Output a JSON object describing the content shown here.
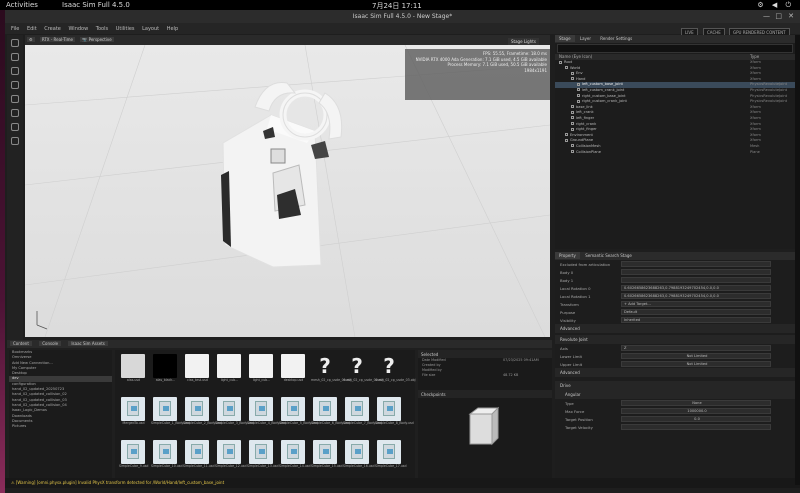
{
  "os": {
    "activities": "Activities",
    "app_name": "Isaac Sim Full 4.5.0",
    "clock": "7月24日  17:11",
    "tray": "⚙ ◀ ⏻"
  },
  "window": {
    "title": "Isaac Sim Full 4.5.0 - New Stage*",
    "minimize": "—",
    "maximize": "□",
    "close": "✕"
  },
  "menu": [
    "File",
    "Edit",
    "Create",
    "Window",
    "Tools",
    "Utilities",
    "Layout",
    "Help"
  ],
  "menu_status": {
    "live": "LIVE",
    "cache": "CACHE",
    "mode": "GPU RENDERED CONTENT"
  },
  "viewport": {
    "toolbar": [
      "⚙",
      "RTX - Real-Time",
      "📷 Perspective"
    ],
    "stage_lights": "Stage Lights",
    "hud": [
      "FPS: 55.55, Frametime: 18.0 ms",
      "NVIDIA RTX 4000 Ada Generation: 7.1 GiB used, 4.5 GiB available",
      "",
      "",
      "Process Memory: 7.1 GiB used, 50.5 GiB available",
      "1984x1191"
    ]
  },
  "stage": {
    "tabs": [
      "Stage",
      "Layer",
      "Render Settings"
    ],
    "columns": {
      "name": "Name (Eye Icon)",
      "type": "Type"
    },
    "rows": [
      {
        "indent": 0,
        "name": "Root",
        "type": "Xform",
        "sel": false
      },
      {
        "indent": 1,
        "name": "World",
        "type": "Xform",
        "sel": false
      },
      {
        "indent": 2,
        "name": "Env",
        "type": "Xform",
        "sel": false
      },
      {
        "indent": 2,
        "name": "Hand",
        "type": "Xform",
        "sel": false
      },
      {
        "indent": 3,
        "name": "left_custom_base_joint",
        "type": "PhysicsRevoluteJoint",
        "sel": true
      },
      {
        "indent": 3,
        "name": "left_custom_crank_joint",
        "type": "PhysicsRevoluteJoint",
        "sel": false
      },
      {
        "indent": 3,
        "name": "right_custom_base_joint",
        "type": "PhysicsRevoluteJoint",
        "sel": false
      },
      {
        "indent": 3,
        "name": "right_custom_crank_joint",
        "type": "PhysicsRevoluteJoint",
        "sel": false
      },
      {
        "indent": 2,
        "name": "base_link",
        "type": "Xform",
        "sel": false
      },
      {
        "indent": 2,
        "name": "left_crank",
        "type": "Xform",
        "sel": false
      },
      {
        "indent": 2,
        "name": "left_finger",
        "type": "Xform",
        "sel": false
      },
      {
        "indent": 2,
        "name": "right_crank",
        "type": "Xform",
        "sel": false
      },
      {
        "indent": 2,
        "name": "right_finger",
        "type": "Xform",
        "sel": false
      },
      {
        "indent": 1,
        "name": "Environment",
        "type": "Xform",
        "sel": false
      },
      {
        "indent": 1,
        "name": "GroundPlane",
        "type": "Xform",
        "sel": false
      },
      {
        "indent": 2,
        "name": "CollisionMesh",
        "type": "Mesh",
        "sel": false
      },
      {
        "indent": 2,
        "name": "CollisionPlane",
        "type": "Plane",
        "sel": false
      }
    ]
  },
  "property": {
    "tabs": [
      "Property",
      "Semantic Search Stage"
    ],
    "rows": [
      {
        "label": "Excluded from articulation",
        "value": ""
      },
      {
        "label": "Body 0",
        "value": ""
      },
      {
        "label": "Body 1",
        "value": ""
      },
      {
        "label": "Local Rotation 0",
        "value": "0.6026658623688263,0.7988193249702454,0.0,0.0"
      },
      {
        "label": "Local Rotation 1",
        "value": "0.6026658623688263,0.7988193249702454,0.0,0.0"
      },
      {
        "label": "Transform",
        "value": "+ Add Target..."
      },
      {
        "label": "Purpose",
        "value": "Default"
      },
      {
        "label": "Visibility",
        "value": "Inherited"
      }
    ],
    "sec_advanced": "Advanced",
    "sec_revolute": "Revolute Joint",
    "axis": {
      "label": "Axis",
      "value": "Z"
    },
    "lower_limit": {
      "label": "Lower Limit",
      "value": "Not Limited"
    },
    "upper_limit": {
      "label": "Upper Limit",
      "value": "Not Limited"
    },
    "sec_advanced2": "Advanced",
    "sec_drive": "Drive",
    "sec_angular": "Angular",
    "drive_rows": [
      {
        "label": "Type",
        "value": "None"
      },
      {
        "label": "Max Force",
        "value": "1000000.0"
      },
      {
        "label": "Target Position",
        "value": "0.0"
      },
      {
        "label": "Target Velocity",
        "value": ""
      }
    ]
  },
  "content": {
    "tabs": [
      "Content",
      "Console",
      "Isaac Sim Assets"
    ],
    "tree": [
      {
        "name": "Bookmarks",
        "sel": false
      },
      {
        "name": "Omniverse",
        "sel": false
      },
      {
        "name": "Add New Connection...",
        "sel": false
      },
      {
        "name": "My Computer",
        "sel": false
      },
      {
        "name": "Desktop",
        "sel": false
      },
      {
        "name": "dev",
        "sel": true
      },
      {
        "name": "configuration",
        "sel": false
      },
      {
        "name": "hand_02_updated_20250723",
        "sel": false
      },
      {
        "name": "hand_02_updated_collision_02",
        "sel": false
      },
      {
        "name": "hand_02_updated_collision_03",
        "sel": false
      },
      {
        "name": "hand_02_updated_collision_04",
        "sel": false
      },
      {
        "name": "Isaac_Logic_Demos",
        "sel": false
      },
      {
        "name": "Downloads",
        "sel": false
      },
      {
        "name": "Documents",
        "sel": false
      },
      {
        "name": "Pictures",
        "sel": false
      }
    ],
    "files": [
      {
        "name": "alas.usd",
        "kind": "dark"
      },
      {
        "name": "alas_black...",
        "kind": "black"
      },
      {
        "name": "clas_test.usd",
        "kind": "white"
      },
      {
        "name": "light_cub...",
        "kind": "white"
      },
      {
        "name": "light_cub...",
        "kind": "white"
      },
      {
        "name": "desktop.usd",
        "kind": "white"
      },
      {
        "name": "mesh_02_cp_usde_01.obj",
        "kind": "q"
      },
      {
        "name": "mesh_02_cp_usde_02.obj",
        "kind": "q"
      },
      {
        "name": "mesh_02_cp_usde_03.obj",
        "kind": "q"
      },
      {
        "name": "MergedTo.usd",
        "kind": "doc"
      },
      {
        "name": "SimpleCube_1_Body.usd",
        "kind": "doc"
      },
      {
        "name": "SimpleCube_2_Body.usd",
        "kind": "doc"
      },
      {
        "name": "SimpleCube_3_Body.usd",
        "kind": "doc"
      },
      {
        "name": "SimpleCube_4_Body.usd",
        "kind": "doc"
      },
      {
        "name": "SimpleCube_5_Body.usd",
        "kind": "doc"
      },
      {
        "name": "SimpleCube_6_Body.usd",
        "kind": "doc"
      },
      {
        "name": "SimpleCube_7_Body.usd",
        "kind": "doc"
      },
      {
        "name": "SimpleCube_8_Body.usd",
        "kind": "doc"
      },
      {
        "name": "SimpleCube_9.usd",
        "kind": "doc"
      },
      {
        "name": "SimpleCube_10.usd",
        "kind": "doc"
      },
      {
        "name": "SimpleCube_11.usd",
        "kind": "doc"
      },
      {
        "name": "SimpleCube_12.usd",
        "kind": "doc"
      },
      {
        "name": "SimpleCube_13.usd",
        "kind": "doc"
      },
      {
        "name": "SimpleCube_14.usd",
        "kind": "doc"
      },
      {
        "name": "SimpleCube_15.usd",
        "kind": "doc"
      },
      {
        "name": "SimpleCube_16.usd",
        "kind": "doc"
      },
      {
        "name": "SimpleCube_17.usd",
        "kind": "doc"
      }
    ],
    "preview": {
      "title": "Selected",
      "rows": [
        {
          "k": "Date Modified",
          "v": "07/23/2025 09:41AM"
        },
        {
          "k": "Created by",
          "v": ""
        },
        {
          "k": "Modified by",
          "v": ""
        },
        {
          "k": "File size",
          "v": "48.72 KB"
        }
      ],
      "checkpoints": "Checkpoints"
    }
  },
  "status": {
    "text": "⚠ [Warning] [omni.physx.plugin] Invalid PhysX transform detected for /World/Hand/left_custom_base_joint"
  }
}
